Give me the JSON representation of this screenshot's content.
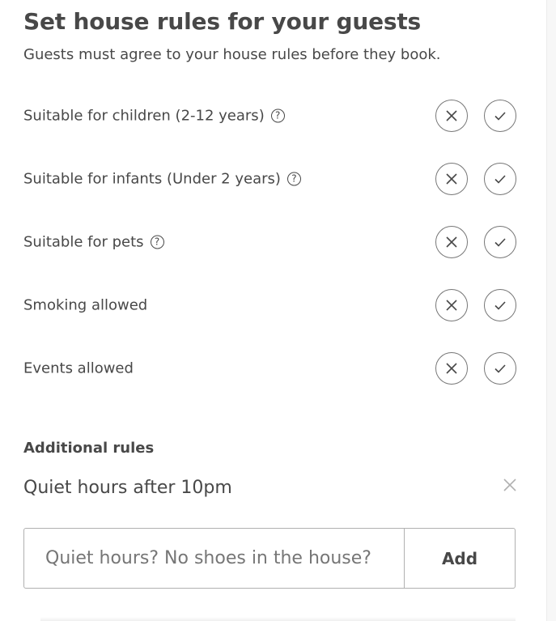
{
  "heading": {
    "title": "Set house rules for your guests",
    "subtitle": "Guests must agree to your house rules before they book."
  },
  "rules": [
    {
      "label": "Suitable for children (2-12 years)",
      "has_help": true,
      "help_icon": "question-circle-icon"
    },
    {
      "label": "Suitable for infants (Under 2 years)",
      "has_help": true,
      "help_icon": "question-circle-icon"
    },
    {
      "label": "Suitable for pets",
      "has_help": true,
      "help_icon": "question-circle-icon"
    },
    {
      "label": "Smoking allowed",
      "has_help": false
    },
    {
      "label": "Events allowed",
      "has_help": false
    }
  ],
  "help_glyph": "?",
  "additional": {
    "label": "Additional rules",
    "rules": [
      "Quiet hours after 10pm"
    ],
    "input_placeholder": "Quiet hours? No shoes in the house?",
    "input_value": "",
    "add_label": "Add"
  },
  "icons": {
    "decline": "close-icon",
    "accept": "checkmark-icon",
    "remove": "close-icon"
  },
  "colors": {
    "text": "#484848",
    "border": "#767676",
    "muted": "#b0b0b0"
  }
}
